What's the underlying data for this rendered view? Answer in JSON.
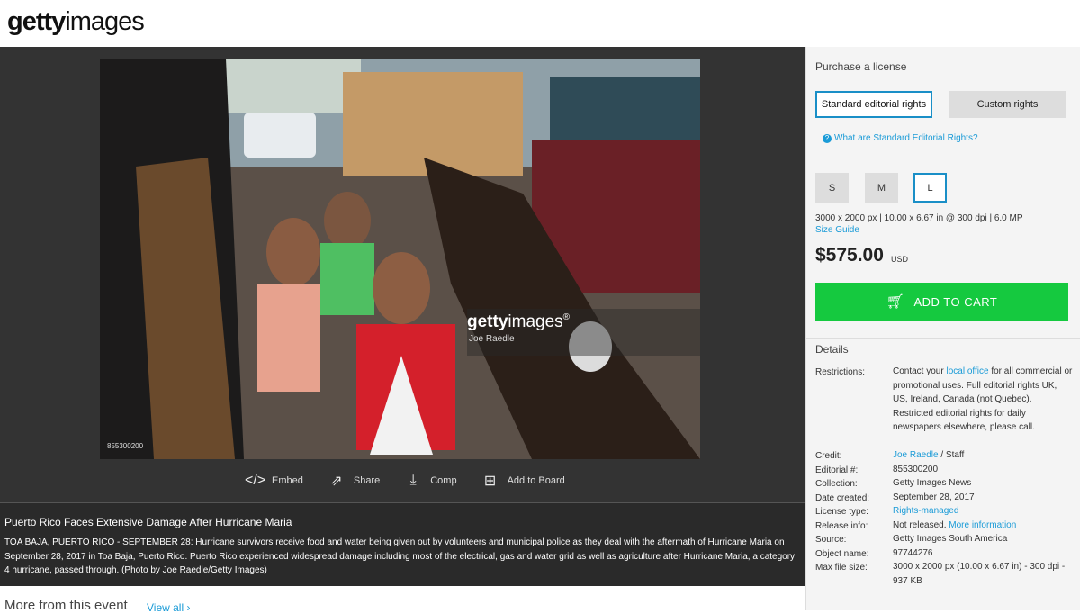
{
  "header": {
    "logo_bold": "getty",
    "logo_light": "images"
  },
  "photo": {
    "watermark_brand_bold": "getty",
    "watermark_brand_light": "images",
    "watermark_registered": "®",
    "watermark_credit": "Joe Raedle",
    "image_id": "855300200"
  },
  "actions": [
    {
      "icon": "code-icon",
      "label": "Embed"
    },
    {
      "icon": "share-icon",
      "label": "Share"
    },
    {
      "icon": "download-icon",
      "label": "Comp"
    },
    {
      "icon": "add-to-board-icon",
      "label": "Add to Board"
    }
  ],
  "caption": {
    "title": "Puerto Rico Faces Extensive Damage After Hurricane Maria",
    "text": "TOA BAJA, PUERTO RICO - SEPTEMBER 28: Hurricane survivors receive food and water being given out by volunteers and municipal police as they deal with the aftermath of Hurricane Maria on September 28, 2017 in Toa Baja, Puerto Rico. Puerto Rico experienced widespread damage including most of the electrical, gas and water grid as well as agriculture after Hurricane Maria, a category 4 hurricane, passed through. (Photo by Joe Raedle/Getty Images)"
  },
  "more": {
    "title": "More from this event",
    "view_all": "View all ›"
  },
  "purchase": {
    "heading": "Purchase a license",
    "rights_standard": "Standard editorial rights",
    "rights_custom": "Custom rights",
    "what_link": "What are Standard Editorial Rights?",
    "sizes": [
      "S",
      "M",
      "L"
    ],
    "selected_size": "L",
    "dimensions": "3000 x 2000 px | 10.00 x 6.67 in @ 300 dpi | 6.0 MP",
    "size_guide": "Size Guide",
    "price": "$575.00",
    "currency": "USD",
    "cart_label": "ADD TO CART"
  },
  "details": {
    "heading": "Details",
    "restrictions_label": "Restrictions:",
    "restrictions_pre": "Contact your ",
    "restrictions_link": "local office",
    "restrictions_post": " for all commercial or promotional uses. Full editorial rights UK, US, Ireland, Canada (not Quebec). Restricted editorial rights for daily newspapers elsewhere, please call.",
    "credit_label": "Credit:",
    "credit_link": "Joe Raedle",
    "credit_post": " / Staff",
    "editorial_label": "Editorial #:",
    "editorial_value": "855300200",
    "collection_label": "Collection:",
    "collection_value": "Getty Images News",
    "date_label": "Date created:",
    "date_value": "September 28, 2017",
    "license_label": "License type:",
    "license_value": "Rights-managed",
    "release_label": "Release info:",
    "release_value": "Not released. ",
    "release_link": "More information",
    "source_label": "Source:",
    "source_value": "Getty Images South America",
    "object_label": "Object name:",
    "object_value": "97744276",
    "maxfile_label": "Max file size:",
    "maxfile_value": "3000 x 2000 px (10.00 x 6.67 in) - 300 dpi - 937 KB"
  }
}
